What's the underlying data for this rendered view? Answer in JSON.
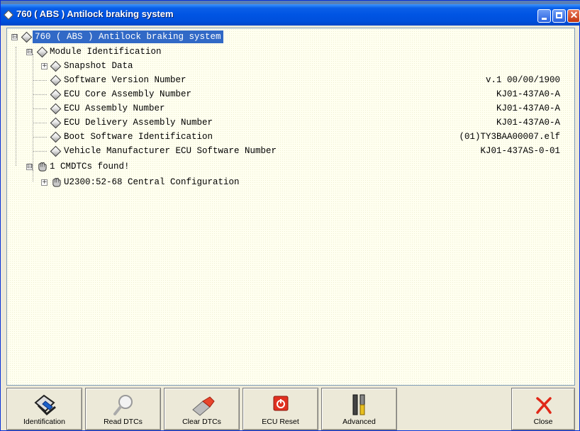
{
  "window": {
    "title": "760 ( ABS ) Antilock braking system",
    "icon": "diamond-icon",
    "controls": {
      "minimize": "minimize-icon",
      "maximize": "maximize-icon",
      "close": "close-icon"
    }
  },
  "tree": {
    "root": {
      "label": "760 ( ABS ) Antilock braking system",
      "expander": "⊟",
      "icon": "diamond-icon",
      "selected": true
    },
    "module": {
      "label": "Module Identification",
      "expander": "⊟",
      "icon": "diamond-icon"
    },
    "items": [
      {
        "label": "Snapshot Data",
        "value": "",
        "expander": "+"
      },
      {
        "label": "Software Version Number",
        "value": "v.1 00/00/1900"
      },
      {
        "label": "ECU Core Assembly Number",
        "value": "KJ01-437A0-A"
      },
      {
        "label": "ECU Assembly Number",
        "value": "KJ01-437A0-A"
      },
      {
        "label": "ECU Delivery Assembly Number",
        "value": "KJ01-437A0-A"
      },
      {
        "label": "Boot Software Identification",
        "value": "(01)TY3BAA00007.elf"
      },
      {
        "label": "Vehicle Manufacturer ECU Software Number",
        "value": "KJ01-437AS-0-01"
      }
    ],
    "dtc_group": {
      "label": "1 CMDTCs found!",
      "expander": "⊟",
      "icon": "dtc-hand-icon"
    },
    "dtcs": [
      {
        "label": "U2300:52-68 Central Configuration",
        "expander": "+",
        "icon": "dtc-hand-icon"
      }
    ]
  },
  "toolbar": {
    "identification": {
      "label": "Identification",
      "icon": "car-wrench-icon"
    },
    "read_dtcs": {
      "label": "Read DTCs",
      "icon": "magnifier-icon"
    },
    "clear_dtcs": {
      "label": "Clear DTCs",
      "icon": "eraser-icon"
    },
    "ecu_reset": {
      "label": "ECU Reset",
      "icon": "power-icon"
    },
    "advanced": {
      "label": "Advanced",
      "icon": "tools-icon"
    },
    "close": {
      "label": "Close",
      "icon": "red-x-icon"
    }
  },
  "colors": {
    "titlebar": "#0054e3",
    "selection": "#3169c6",
    "tree_bg": "#fffff0",
    "accent_red": "#e03020"
  }
}
